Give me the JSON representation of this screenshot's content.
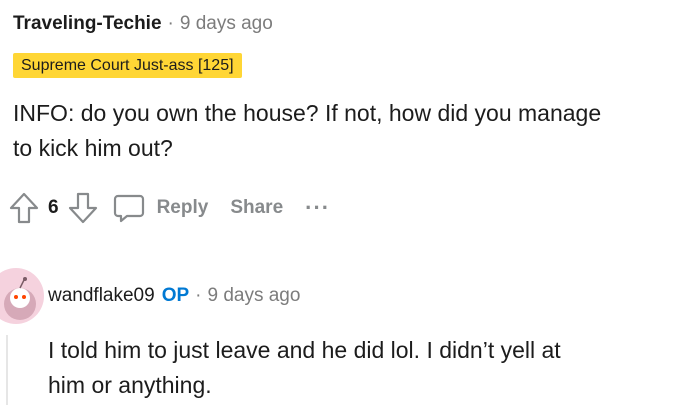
{
  "comment1": {
    "author": "Traveling-Techie",
    "separator": "·",
    "time": "9 days ago",
    "flair": "Supreme Court Just-ass [125]",
    "body_line1": "INFO: do you own the house? If not, how did you manage",
    "body_line2": "to kick him out?",
    "score": "6",
    "reply_label": "Reply",
    "share_label": "Share",
    "more_label": "···"
  },
  "comment2": {
    "author": "wandflake09",
    "op_badge": "OP",
    "separator": "·",
    "time": "9 days ago",
    "body_line1": "I told him to just leave and he did lol. I didn’t yell at",
    "body_line2": "him or anything."
  },
  "icons": {
    "upvote": "upvote-arrow-icon",
    "downvote": "downvote-arrow-icon",
    "reply": "speech-bubble-icon",
    "avatar": "snoo-avatar-icon"
  },
  "colors": {
    "flair_bg": "#ffd635",
    "op_blue": "#0079d3",
    "muted": "#878a8c",
    "avatar_bg": "#f5d2de"
  }
}
